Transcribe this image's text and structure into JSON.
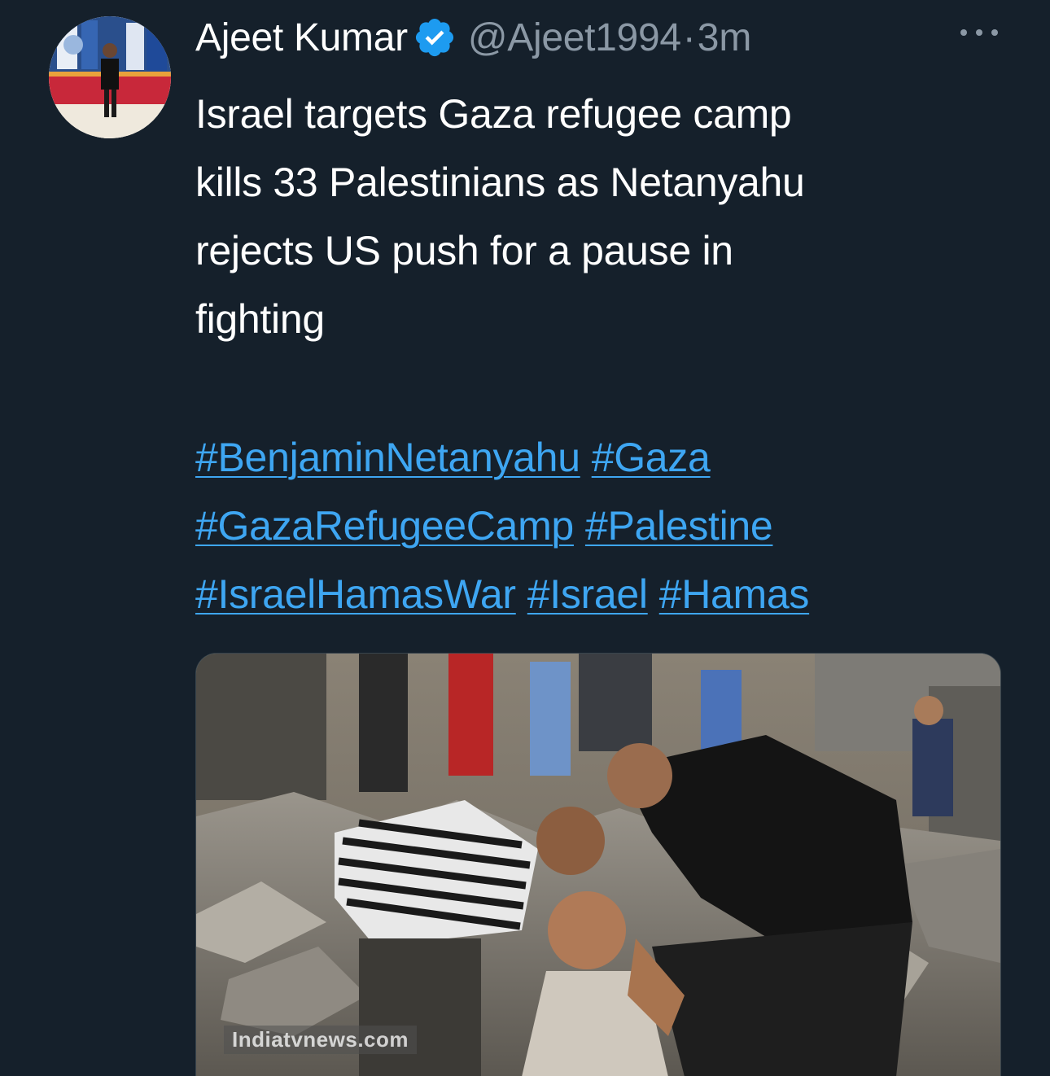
{
  "tweet": {
    "author": {
      "display_name": "Ajeet Kumar",
      "handle": "@Ajeet1994",
      "verified": true,
      "avatar_icon": "profile-photo"
    },
    "separator": "·",
    "time": "3m",
    "more_icon": "ellipsis-icon",
    "text_lines": [
      "Israel targets Gaza refugee camp",
      "kills 33 Palestinians as Netanyahu",
      "rejects US push for a pause in",
      "fighting"
    ],
    "hashtag_rows": [
      [
        "#BenjaminNetanyahu",
        "#Gaza"
      ],
      [
        "#GazaRefugeeCamp",
        "#Palestine"
      ],
      [
        "#IsraelHamasWar",
        "#Israel",
        "#Hamas"
      ]
    ],
    "media": {
      "watermark": "Indiatvnews.com"
    }
  },
  "colors": {
    "background": "#15202b",
    "text": "#ffffff",
    "secondary_text": "#8b98a5",
    "link": "#3ea6f2",
    "verified_badge": "#1d9bf0"
  }
}
